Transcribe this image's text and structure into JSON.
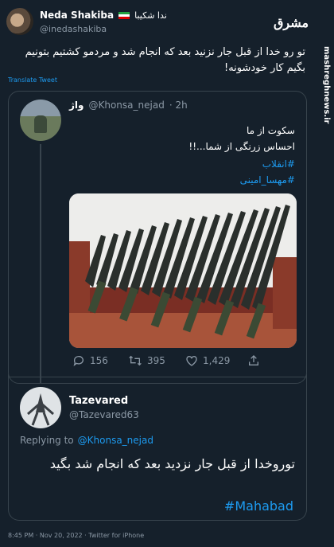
{
  "tweet": {
    "author_name_latin": "Neda Shakiba",
    "author_name_persian": "ندا شکیبا",
    "handle": "@inedashakiba",
    "text": "تو رو خدا از قبل جار نزنید بعد که انجام شد و مردمو کشتیم بتونیم بگیم کار خودشونه!",
    "translate_label": "Translate Tweet",
    "footer": "8:45 PM · Nov 20, 2022 · Twitter for iPhone"
  },
  "quoted": {
    "author_name": "واژ",
    "handle": "@Khonsa_nejad",
    "time": "· 2h",
    "line1": "سکوت از ما",
    "line2": "احساس زرنگی از شما...!!",
    "hashtag1": "#انقلاب",
    "hashtag2": "#مهسا_امینی",
    "replies": "156",
    "retweets": "395",
    "likes": "1,429"
  },
  "reply": {
    "author_name": "Tazevared",
    "handle": "@Tazevared63",
    "replying_prefix": "Replying to",
    "replying_handle": "@Khonsa_nejad",
    "text": "توروخدا از قبل جار نزدید بعد که انجام شد بگید",
    "hashtag": "#Mahabad"
  },
  "watermark": {
    "logo_text": "مشرق",
    "site": "mashreghnews.ir"
  },
  "colors": {
    "background": "#15202b",
    "link": "#1d9bf0",
    "muted": "#8b98a5",
    "border": "#38444d"
  }
}
